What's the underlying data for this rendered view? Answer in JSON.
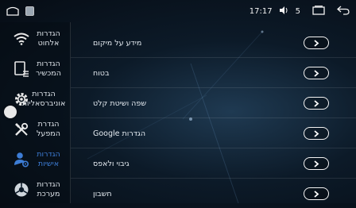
{
  "status_bar": {
    "time": "17:17",
    "volume_level": "5",
    "icons": [
      "home-icon",
      "app-thumbnail-icon",
      "volume-icon",
      "recent-apps-icon",
      "back-icon"
    ]
  },
  "sidebar": {
    "items": [
      {
        "label": "הגדרות אלחוט",
        "icon": "wifi-icon",
        "active": false
      },
      {
        "label": "הגדרות המכשיר",
        "icon": "device-icon",
        "active": false
      },
      {
        "label": "הגדרות אוניברסאליות",
        "icon": "gear-icon",
        "active": false
      },
      {
        "label": "הגדרת המפעל",
        "icon": "tools-icon",
        "active": false
      },
      {
        "label": "הגדרות אישיות",
        "icon": "person-settings-icon",
        "active": true
      },
      {
        "label": "הגדרות מערכת",
        "icon": "system-icon",
        "active": false
      }
    ]
  },
  "settings": {
    "rows": [
      {
        "label": "מידע על מיקום"
      },
      {
        "label": "בטוח"
      },
      {
        "label": "שפה ושיטת קלט"
      },
      {
        "label": "הגדרות Google"
      },
      {
        "label": "גיבוי ולאפס"
      },
      {
        "label": "חשבון"
      }
    ],
    "row_button_icon": "chevron-right-icon"
  },
  "colors": {
    "accent": "#3d7dd6",
    "text": "#e6ecf2",
    "background": "#0c1a28"
  }
}
